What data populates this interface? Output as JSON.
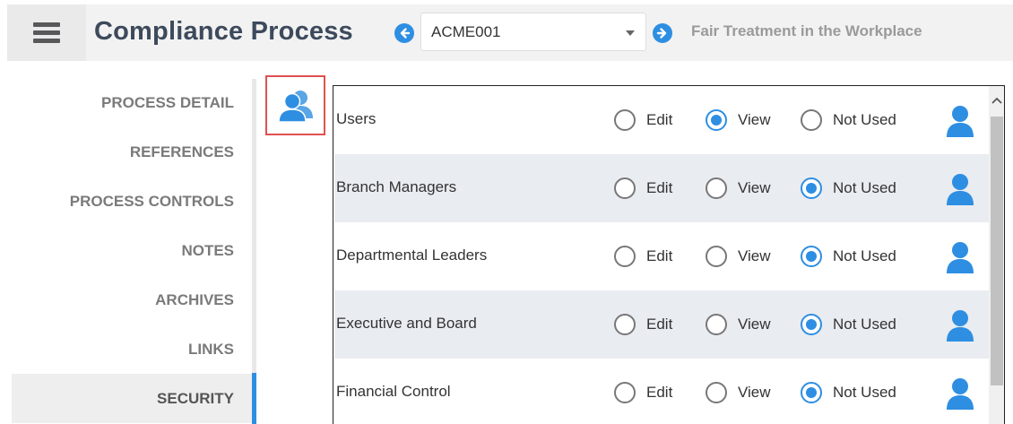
{
  "header": {
    "menu_icon": "hamburger-icon",
    "title": "Compliance Process",
    "prev_icon": "arrow-left-circle-icon",
    "next_icon": "arrow-right-circle-icon",
    "process_select": {
      "value": "ACME001"
    },
    "process_name": "Fair Treatment in the Workplace"
  },
  "nav": {
    "items": [
      {
        "label": "PROCESS DETAIL"
      },
      {
        "label": "REFERENCES"
      },
      {
        "label": "PROCESS CONTROLS"
      },
      {
        "label": "NOTES"
      },
      {
        "label": "ARCHIVES"
      },
      {
        "label": "LINKS"
      },
      {
        "label": "SECURITY"
      }
    ],
    "active": "SECURITY"
  },
  "security": {
    "group_icon": "user-group-icon",
    "option_labels": {
      "edit": "Edit",
      "view": "View",
      "not_used": "Not Used"
    },
    "rows": [
      {
        "label": "Users",
        "selected": "view"
      },
      {
        "label": "Branch Managers",
        "selected": "not_used"
      },
      {
        "label": "Departmental Leaders",
        "selected": "not_used"
      },
      {
        "label": "Executive and Board",
        "selected": "not_used"
      },
      {
        "label": "Financial Control",
        "selected": "not_used"
      }
    ],
    "row_icon": "user-icon"
  },
  "colors": {
    "accent": "#2e8ee2",
    "title": "#3d4a5c",
    "highlight_border": "#e05050"
  }
}
